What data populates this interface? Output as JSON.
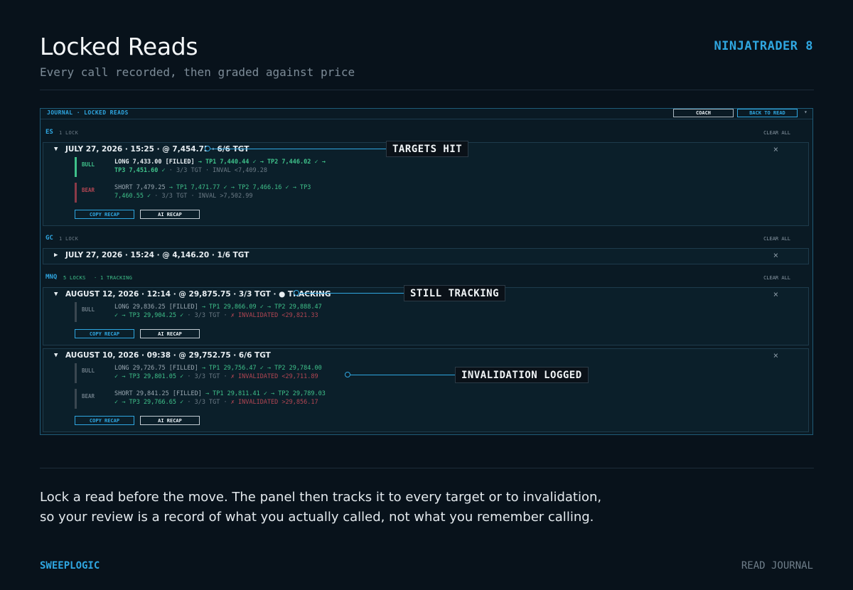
{
  "header": {
    "title": "Locked Reads",
    "subtitle": "Every call recorded, then graded against price",
    "brand": "NINJATRADER 8"
  },
  "shot": {
    "breadcrumb": "JOURNAL · LOCKED READS",
    "coach_label": "COACH",
    "back_label": "BACK TO READ",
    "menu_icon": "▾",
    "clear_all": "CLEAR ALL",
    "close_icon": "×",
    "caret_open": "▼",
    "caret_closed": "▶",
    "copy_recap": "COPY RECAP",
    "ai_recap": "AI RECAP",
    "groups": {
      "es": {
        "symbol": "ES",
        "count": "1 LOCK",
        "card": {
          "title": "JULY 27, 2026 · 15:25 · @ 7,454.75 · 6/6 TGT",
          "bull": {
            "tag": "BULL",
            "line1": [
              "LONG 7,433.00 [FILLED]",
              " → TP1 7,440.44 ✓ → TP2 7,446.02 ✓ →"
            ],
            "line2": [
              "TP3 7,451.60 ✓",
              " · 3/3 TGT · INVAL <7,409.28"
            ]
          },
          "bear": {
            "tag": "BEAR",
            "line1": [
              "SHORT 7,479.25",
              " → TP1 7,471.77 ✓ → TP2 7,466.16 ✓ → TP3"
            ],
            "line2": [
              "7,460.55 ✓",
              " · 3/3 TGT · INVAL >7,502.99"
            ]
          }
        }
      },
      "gc": {
        "symbol": "GC",
        "count": "1 LOCK",
        "card": {
          "title": "JULY 27, 2026 · 15:24 · @ 4,146.20 · 1/6 TGT"
        }
      },
      "mnq": {
        "symbol": "MNQ",
        "count": "5 LOCKS",
        "tracking": "· 1 TRACKING",
        "card1": {
          "title": "AUGUST 12, 2026 · 12:14 · @ 29,875.75 · 3/3 TGT · ● TRACKING",
          "bull": {
            "tag": "BULL",
            "line1": [
              "LONG 29,836.25 [FILLED]",
              " → TP1 29,866.09 ✓ → TP2 29,888.47"
            ],
            "line2": [
              "✓ → TP3 29,904.25 ✓",
              " · 3/3 TGT · ",
              "✗ INVALIDATED <29,821.33"
            ]
          }
        },
        "card2": {
          "title": "AUGUST 10, 2026 · 09:38 · @ 29,752.75 · 6/6 TGT",
          "bull": {
            "tag": "BULL",
            "line1": [
              "LONG 29,726.75 [FILLED]",
              " → TP1 29,756.47 ✓ → TP2 29,784.00"
            ],
            "line2": [
              "✓ → TP3 29,801.05 ✓",
              " · 3/3 TGT · ",
              "✗ INVALIDATED <29,711.89"
            ]
          },
          "bear": {
            "tag": "BEAR",
            "line1": [
              "SHORT 29,841.25 [FILLED]",
              " → TP1 29,811.41 ✓ → TP2 29,789.03"
            ],
            "line2": [
              "✓ → TP3 29,766.65 ✓",
              " · 3/3 TGT · ",
              "✗ INVALIDATED >29,856.17"
            ]
          }
        }
      }
    }
  },
  "callouts": {
    "targets": "TARGETS HIT",
    "tracking": "STILL TRACKING",
    "invalidation": "INVALIDATION LOGGED"
  },
  "description": {
    "line1": "Lock a read before the move. The panel then tracks it to every target or to invalidation,",
    "line2": "so your review is a record of what you actually called, not what you remember calling."
  },
  "footer": {
    "brand": "SWEEPLOGIC",
    "link": "READ JOURNAL"
  },
  "colors": {
    "accent": "#2fa6e0",
    "green": "#3fc18a",
    "red": "#b34653",
    "bull_bar": "#3fc18a",
    "bear_bar": "#8a3a48"
  }
}
